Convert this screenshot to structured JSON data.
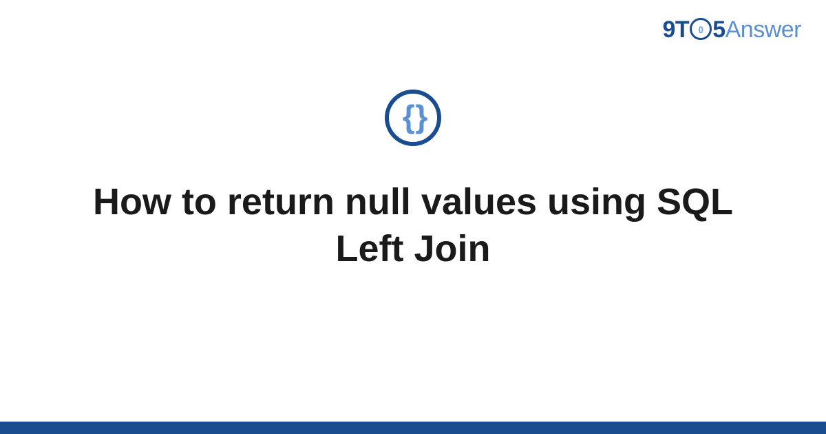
{
  "logo": {
    "part1": "9T",
    "part2": "5",
    "part3": "Answer"
  },
  "icon": {
    "braces": "{ }"
  },
  "title": "How to return null values using SQL Left Join"
}
